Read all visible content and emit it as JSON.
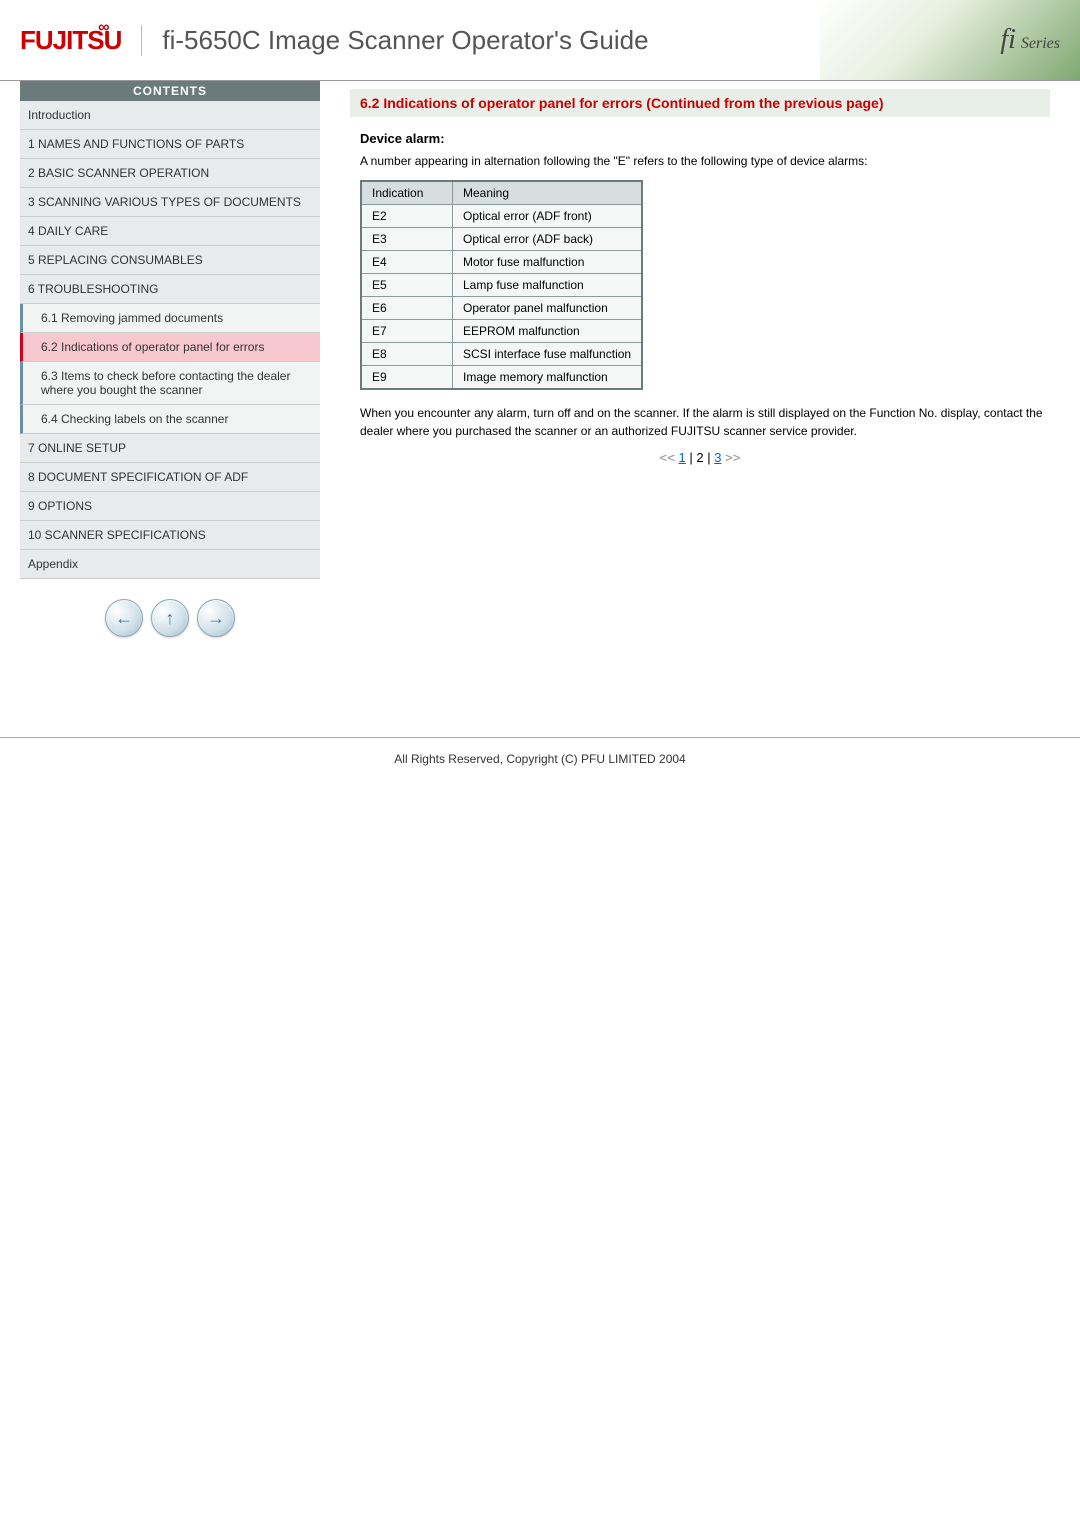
{
  "header": {
    "logo_text": "FUJITSU",
    "title": "fi-5650C Image Scanner Operator's Guide",
    "series_label": "fi Series"
  },
  "sidebar": {
    "contents_label": "CONTENTS",
    "items": [
      {
        "label": "Introduction",
        "type": "top"
      },
      {
        "label": "1 NAMES AND FUNCTIONS OF PARTS",
        "type": "top"
      },
      {
        "label": "2 BASIC SCANNER OPERATION",
        "type": "top"
      },
      {
        "label": "3 SCANNING VARIOUS TYPES OF DOCUMENTS",
        "type": "top"
      },
      {
        "label": "4 DAILY CARE",
        "type": "top"
      },
      {
        "label": "5 REPLACING CONSUMABLES",
        "type": "top"
      },
      {
        "label": "6 TROUBLESHOOTING",
        "type": "top"
      },
      {
        "label": "6.1 Removing jammed documents",
        "type": "sub"
      },
      {
        "label": "6.2 Indications of operator panel for errors",
        "type": "sub",
        "active": true
      },
      {
        "label": "6.3 Items to check before contacting the dealer where you bought the scanner",
        "type": "sub"
      },
      {
        "label": "6.4 Checking labels on the scanner",
        "type": "sub"
      },
      {
        "label": "7 ONLINE SETUP",
        "type": "top"
      },
      {
        "label": "8 DOCUMENT SPECIFICATION OF ADF",
        "type": "top"
      },
      {
        "label": "9 OPTIONS",
        "type": "top"
      },
      {
        "label": "10 SCANNER SPECIFICATIONS",
        "type": "top"
      },
      {
        "label": "Appendix",
        "type": "top"
      }
    ]
  },
  "nav": {
    "back": "←",
    "up": "↑",
    "forward": "→"
  },
  "content": {
    "section_title": "6.2 Indications of operator panel for errors (Continued from the previous page)",
    "device_alarm_heading": "Device alarm:",
    "device_alarm_intro": "A number appearing in alternation following the \"E\" refers to the following type of device alarms:",
    "table": {
      "col1": "Indication",
      "col2": "Meaning",
      "rows": [
        {
          "ind": "E2",
          "mean": "Optical error (ADF front)"
        },
        {
          "ind": "E3",
          "mean": "Optical error (ADF back)"
        },
        {
          "ind": "E4",
          "mean": "Motor fuse malfunction"
        },
        {
          "ind": "E5",
          "mean": "Lamp fuse malfunction"
        },
        {
          "ind": "E6",
          "mean": "Operator panel malfunction"
        },
        {
          "ind": "E7",
          "mean": "EEPROM malfunction"
        },
        {
          "ind": "E8",
          "mean": "SCSI interface fuse malfunction"
        },
        {
          "ind": "E9",
          "mean": "Image memory malfunction"
        }
      ]
    },
    "alarm_note": "When you encounter any alarm, turn off and on the scanner. If the alarm is still displayed on the Function No. display, contact the dealer where you purchased the scanner or an authorized FUJITSU scanner service provider.",
    "pager": {
      "prev": "<<",
      "p1": "1",
      "sep": " | ",
      "p2": "2",
      "p3": "3",
      "next": ">>"
    }
  },
  "footer": {
    "text": "All Rights Reserved, Copyright (C) PFU LIMITED 2004"
  }
}
